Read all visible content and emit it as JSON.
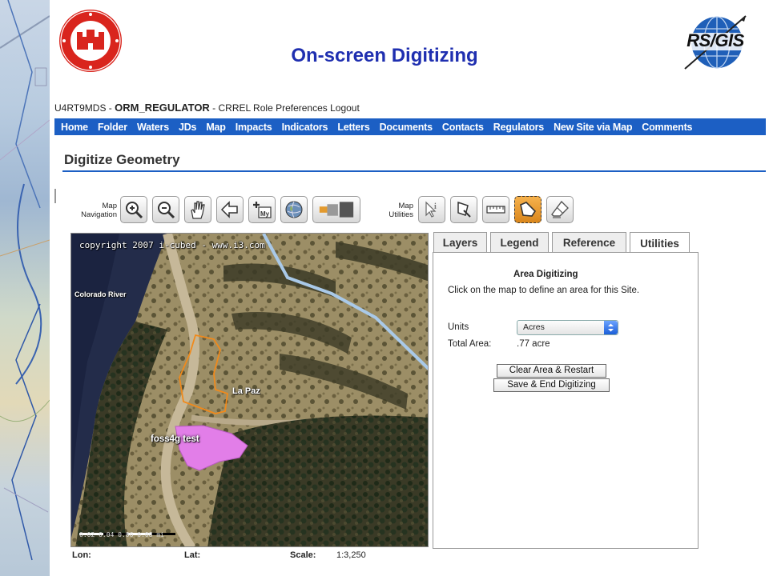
{
  "slide": {
    "title": "On-screen Digitizing"
  },
  "logos": {
    "left_name": "U.S. Army Corps of Engineers logo",
    "right_text": "RS/GIS"
  },
  "app": {
    "user_id": "U4RT9MDS - ",
    "role": "ORM_REGULATOR",
    "user_suffix": " - CRREL Role Preferences Logout",
    "nav": [
      "Home",
      "Folder",
      "Waters",
      "JDs",
      "Map",
      "Impacts",
      "Indicators",
      "Letters",
      "Documents",
      "Contacts",
      "Regulators",
      "New Site via Map",
      "Comments"
    ],
    "page_heading": "Digitize Geometry"
  },
  "toolbar": {
    "nav_label_line1": "Map",
    "nav_label_line2": "Navigation",
    "util_label_line1": "Map",
    "util_label_line2": "Utilities",
    "nav_icons": [
      "zoom-in-icon",
      "zoom-out-icon",
      "pan-hand-icon",
      "back-arrow-icon",
      "my-extent-icon",
      "globe-icon",
      "layers-swap-icon"
    ],
    "util_icons": [
      "identify-icon",
      "select-icon",
      "measure-ruler-icon",
      "area-digitize-icon",
      "clear-eraser-icon"
    ],
    "active_util": "area-digitize-icon"
  },
  "map": {
    "copyright": "copyright 2007 i-cubed - www.i3.com",
    "river_label": "Colorado River",
    "place_label": "La Paz",
    "polygon_label": "foss4g test",
    "scale_text": "0.02  0.04  0.06  0.08 mi",
    "colors": {
      "digitized_outline": "#f08a1c",
      "test_polygon_fill": "#e27ee8",
      "road_line": "#a9c9e8"
    }
  },
  "coords": {
    "lon_label": "Lon:",
    "lat_label": "Lat:",
    "scale_label": "Scale:",
    "scale_value": "1:3,250"
  },
  "panel": {
    "tabs": [
      "Layers",
      "Legend",
      "Reference",
      "Utilities"
    ],
    "selected_tab": "Utilities",
    "title": "Area Digitizing",
    "instructions": "Click on the map to define an area for this Site.",
    "units_label": "Units",
    "units_value": "Acres",
    "total_label": "Total Area:",
    "total_value": ".77 acre",
    "clear_button": "Clear Area & Restart",
    "save_button": "Save & End Digitizing"
  }
}
